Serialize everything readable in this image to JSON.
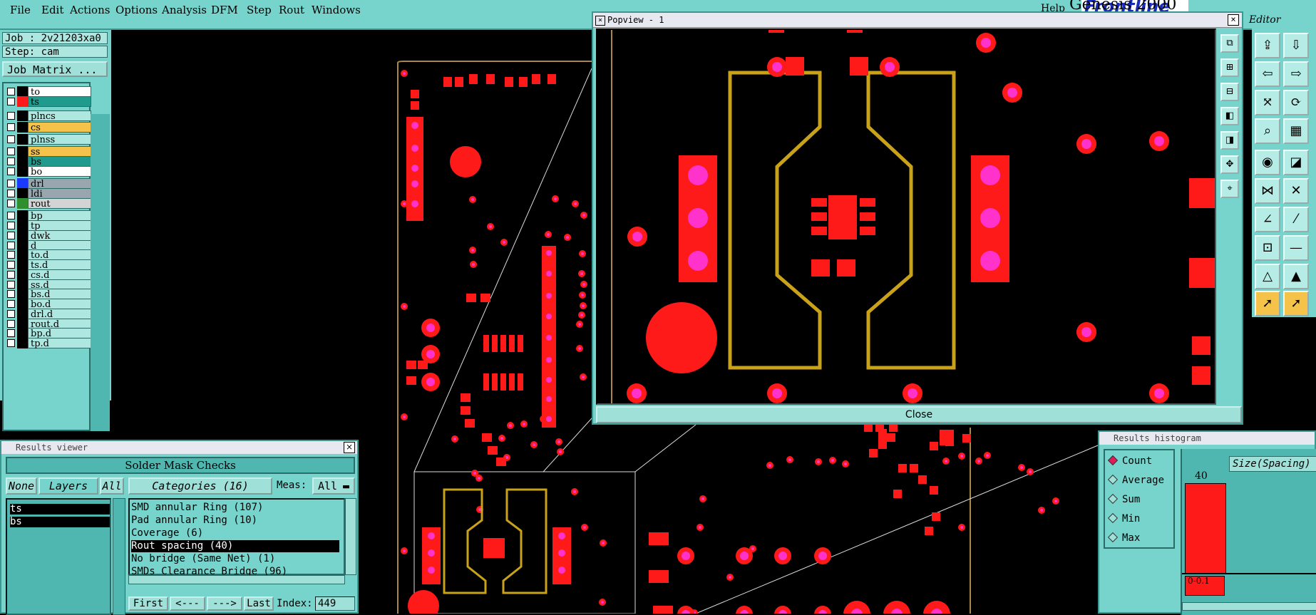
{
  "menu": [
    "File",
    "Edit",
    "Actions",
    "Options",
    "Analysis",
    "DFM",
    "Step",
    "Rout",
    "Windows"
  ],
  "brand": {
    "name": "Genesis 2000",
    "logo": "Frontline",
    "help": "Help",
    "mode": "Editor"
  },
  "job": {
    "job_label": "Job : 2v21203xa0",
    "step_label": "Step: cam",
    "matrix_button": "Job Matrix ..."
  },
  "layers": [
    {
      "name": "to",
      "swatch": "#000000",
      "bg": "#ffffff"
    },
    {
      "name": "ts",
      "swatch": "#ff1a1a",
      "bg": "#1f9a8c",
      "active": true
    },
    {
      "name": "plncs",
      "swatch": "#000000",
      "bg": "#aee6e0"
    },
    {
      "name": "cs",
      "swatch": "#000000",
      "bg": "#f5c34a"
    },
    {
      "name": "plnss",
      "swatch": "#000000",
      "bg": "#aee6e0"
    },
    {
      "name": "ss",
      "swatch": "#000000",
      "bg": "#f5c34a"
    },
    {
      "name": "bs",
      "swatch": "#000000",
      "bg": "#1f9a8c"
    },
    {
      "name": "bo",
      "swatch": "#000000",
      "bg": "#ffffff"
    },
    {
      "name": "drl",
      "swatch": "#1a3aff",
      "bg": "#9aa6ad"
    },
    {
      "name": "ldi",
      "swatch": "#000000",
      "bg": "#9aa6ad"
    },
    {
      "name": "rout",
      "swatch": "#2f8f2f",
      "bg": "#d4d4d4"
    },
    {
      "name": "bp",
      "swatch": "#000000",
      "bg": "#aee6e0"
    },
    {
      "name": "tp",
      "swatch": "#000000",
      "bg": "#aee6e0"
    },
    {
      "name": "dwk",
      "swatch": "#000000",
      "bg": "#aee6e0"
    },
    {
      "name": "d",
      "swatch": "#000000",
      "bg": "#aee6e0"
    },
    {
      "name": "to.d",
      "swatch": "#000000",
      "bg": "#aee6e0"
    },
    {
      "name": "ts.d",
      "swatch": "#000000",
      "bg": "#aee6e0"
    },
    {
      "name": "cs.d",
      "swatch": "#000000",
      "bg": "#aee6e0"
    },
    {
      "name": "ss.d",
      "swatch": "#000000",
      "bg": "#aee6e0"
    },
    {
      "name": "bs.d",
      "swatch": "#000000",
      "bg": "#aee6e0"
    },
    {
      "name": "bo.d",
      "swatch": "#000000",
      "bg": "#aee6e0"
    },
    {
      "name": "drl.d",
      "swatch": "#000000",
      "bg": "#aee6e0"
    },
    {
      "name": "rout.d",
      "swatch": "#000000",
      "bg": "#aee6e0"
    },
    {
      "name": "bp.d",
      "swatch": "#000000",
      "bg": "#aee6e0"
    },
    {
      "name": "tp.d",
      "swatch": "#000000",
      "bg": "#aee6e0"
    }
  ],
  "popview": {
    "title": "Popview - 1",
    "close_label": "Close"
  },
  "results_viewer": {
    "title": "Results viewer",
    "header": "Solder Mask Checks",
    "none_btn": "None",
    "layers_btn": "Layers",
    "all_btn": "All",
    "categories_btn": "Categories (16)",
    "meas_label": "Meas:",
    "meas_value": "All",
    "result_layers": [
      "ts",
      "bs"
    ],
    "categories": [
      "SMD annular Ring (107)",
      "Pad annular Ring (10)",
      "Coverage (6)",
      "Rout spacing (40)",
      "No bridge (Same Net) (1)",
      "SMDs Clearance Bridge (96)"
    ],
    "selected_category": "Rout spacing (40)",
    "nav": {
      "first": "First",
      "prev": "<---",
      "next": "--->",
      "last": "Last",
      "index_label": "Index:",
      "index_value": "449"
    }
  },
  "histogram": {
    "title": "Results histogram",
    "options": [
      "Count",
      "Average",
      "Sum",
      "Min",
      "Max"
    ],
    "selected": "Count",
    "field": "Size(Spacing)",
    "bar_value": "40",
    "bar_range": "0-0.1"
  },
  "colors": {
    "panel": "#76d4cc",
    "pad": "#ff1a1a",
    "drill": "#ff33cc",
    "trace": "#c9a21a"
  }
}
